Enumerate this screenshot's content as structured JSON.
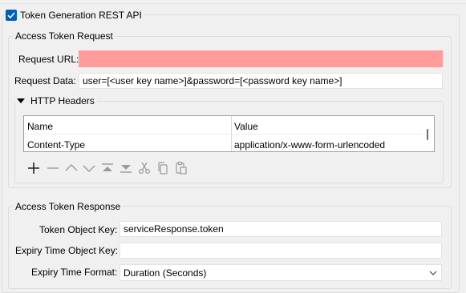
{
  "token_rest_api": {
    "checkbox_label": "Token Generation REST API",
    "checked": true
  },
  "access_token_request": {
    "group_title": "Access Token Request",
    "request_url_label": "Request URL:",
    "request_url_value": "",
    "request_data_label": "Request Data:",
    "request_data_value": "user=[<user key name>]&password=[<password key name>]",
    "http_headers": {
      "title": "HTTP Headers",
      "columns": [
        "Name",
        "Value"
      ],
      "rows": [
        {
          "name": "Content-Type",
          "value": "application/x-www-form-urlencoded"
        }
      ]
    },
    "toolbar_icons": [
      "add-icon",
      "remove-icon",
      "move-up-icon",
      "move-down-icon",
      "move-to-top-icon",
      "move-to-bottom-icon",
      "cut-icon",
      "copy-icon",
      "paste-icon"
    ]
  },
  "access_token_response": {
    "group_title": "Access Token Response",
    "token_key_label": "Token Object Key:",
    "token_key_value": "serviceResponse.token",
    "expiry_key_label": "Expiry Time Object Key:",
    "expiry_key_value": "",
    "expiry_format_label": "Expiry Time Format:",
    "expiry_format_value": "Duration (Seconds)"
  },
  "colors": {
    "error_field": "#ff9b9b",
    "checkbox_accent": "#005fb8"
  }
}
